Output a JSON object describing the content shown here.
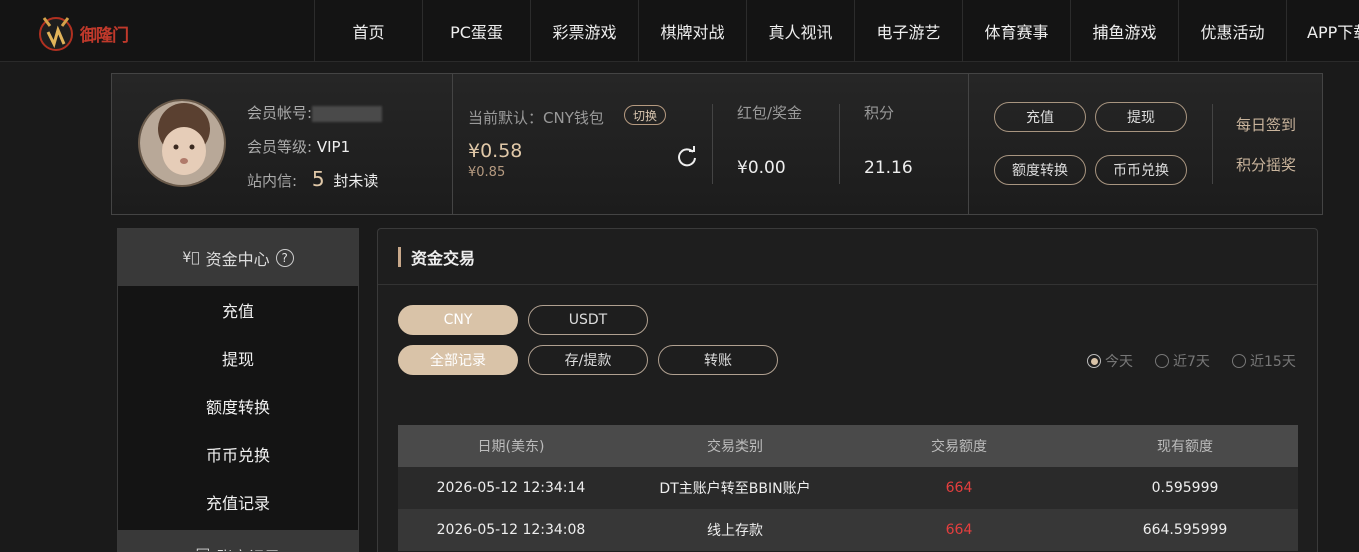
{
  "brand": {
    "name": "御隆门"
  },
  "nav": {
    "items": [
      "首页",
      "PC蛋蛋",
      "彩票游戏",
      "棋牌对战",
      "真人视讯",
      "电子游艺",
      "体育赛事",
      "捕鱼游戏",
      "优惠活动",
      "APP下载"
    ]
  },
  "member": {
    "account_label": "会员帐号:",
    "level_label": "会员等级:",
    "level_value": "VIP1",
    "mail_label": "站内信:",
    "mail_count": "5",
    "mail_suffix": "封未读",
    "wallet_label": "当前默认：CNY钱包",
    "switch_label": "切换",
    "balance": "¥0.58",
    "balance_sub": "¥0.85",
    "bonus_label": "红包/奖金",
    "bonus_value": "¥0.00",
    "points_label": "积分",
    "points_value": "21.16",
    "btn_deposit": "充值",
    "btn_withdraw": "提现",
    "btn_transfer": "额度转换",
    "btn_exchange": "币币兑换",
    "daily_checkin": "每日签到",
    "points_lottery": "积分摇奖"
  },
  "sidebar": {
    "title": "资金中心",
    "items": [
      "充值",
      "提现",
      "额度转换",
      "币币兑换",
      "充值记录"
    ],
    "next_section": "账户记录"
  },
  "panel": {
    "title": "资金交易",
    "currency_tabs": [
      "CNY",
      "USDT"
    ],
    "type_tabs": [
      "全部记录",
      "存/提款",
      "转账"
    ],
    "range_options": [
      "今天",
      "近7天",
      "近15天"
    ],
    "table": {
      "headers": [
        "日期(美东)",
        "交易类别",
        "交易额度",
        "现有额度"
      ],
      "rows": [
        [
          "2026-05-12 12:34:14",
          "DT主账户转至BBIN账户",
          "664",
          "0.595999"
        ],
        [
          "2026-05-12 12:34:08",
          "线上存款",
          "664",
          "664.595999"
        ]
      ]
    }
  },
  "colors": {
    "accent": "#d9c3a8",
    "negative": "#e53e3e",
    "background": "#1a1a1a"
  }
}
